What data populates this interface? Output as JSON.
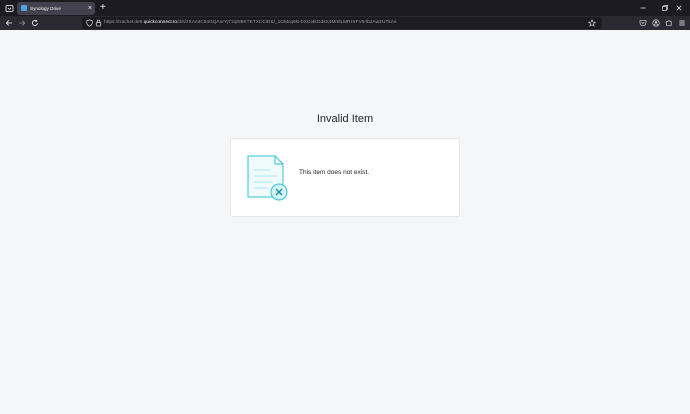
{
  "browser": {
    "tab": {
      "title": "Synology Drive",
      "close_glyph": "×",
      "favicon": "synology-drive-icon"
    },
    "new_tab_glyph": "+",
    "address": {
      "prefix": "https://rrachel.de5.",
      "host": "quickconnect.to",
      "path": "/d/s/zXAe4C54GQAnrYjT2qr89KTKTXCCiDS/_1GMcq9lo-bXGi4kGdsX4MmlLMRHrFV8-lb2AwZUTkAs"
    },
    "toolbar_icons": [
      "back-icon",
      "forward-icon",
      "reload-icon",
      "shield-icon",
      "lock-icon",
      "star-icon",
      "pocket-icon",
      "extensions-icon",
      "account-icon",
      "menu-icon"
    ],
    "window_controls": [
      "minimize",
      "restore",
      "close"
    ]
  },
  "page": {
    "title": "Invalid Item",
    "message": "This item does not exist.",
    "icon": "invalid-document-icon"
  },
  "colors": {
    "accent": "#2ec4d3",
    "page_bg": "#f5f6f8",
    "card_bg": "#ffffff"
  }
}
